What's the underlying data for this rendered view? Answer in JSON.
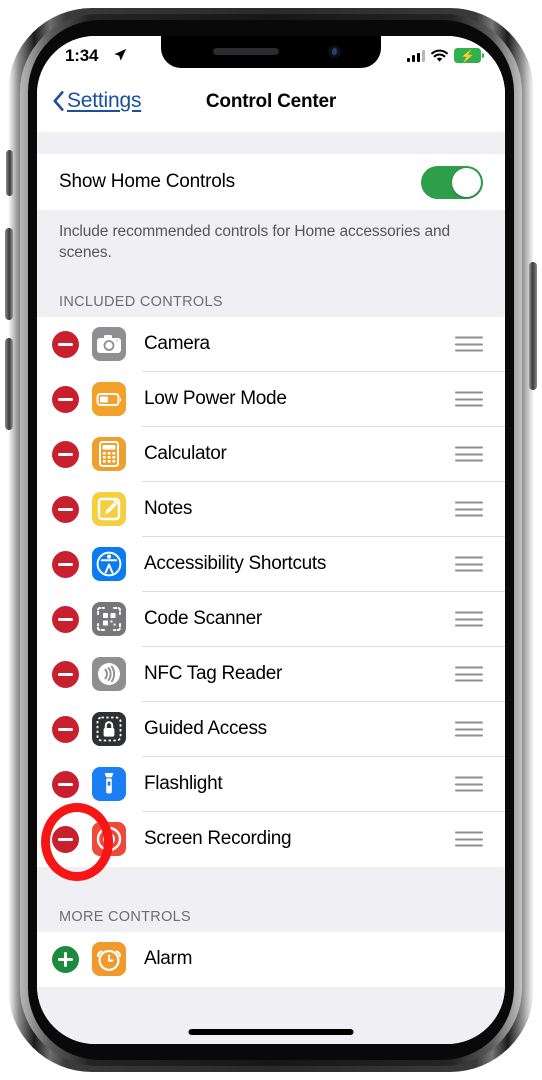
{
  "status_bar": {
    "time": "1:34",
    "location_icon": "location-arrow-icon",
    "signal_icon": "cellular-bars-icon",
    "wifi_icon": "wifi-icon",
    "battery_icon": "battery-charging-icon",
    "battery_bolt": "⚡"
  },
  "nav": {
    "back_label": "Settings",
    "back_icon": "chevron-left-icon",
    "title": "Control Center"
  },
  "home_controls": {
    "label": "Show Home Controls",
    "toggle_state": "on",
    "toggle_color": "#2e9e4a",
    "footnote": "Include recommended controls for Home accessories and scenes."
  },
  "included": {
    "header": "INCLUDED CONTROLS",
    "items": [
      {
        "label": "Camera",
        "icon": "camera-icon",
        "icon_color": "#8e8e93",
        "action": "remove",
        "handle": "drag-handle-icon"
      },
      {
        "label": "Low Power Mode",
        "icon": "battery-low-icon",
        "icon_color": "#f2a12a",
        "action": "remove",
        "handle": "drag-handle-icon"
      },
      {
        "label": "Calculator",
        "icon": "calculator-icon",
        "icon_color": "#eda02c",
        "action": "remove",
        "handle": "drag-handle-icon"
      },
      {
        "label": "Notes",
        "icon": "notes-pencil-icon",
        "icon_color": "#f7ce3e",
        "action": "remove",
        "handle": "drag-handle-icon"
      },
      {
        "label": "Accessibility Shortcuts",
        "icon": "accessibility-icon",
        "icon_color": "#0b7cf0",
        "action": "remove",
        "handle": "drag-handle-icon"
      },
      {
        "label": "Code Scanner",
        "icon": "qr-scanner-icon",
        "icon_color": "#76767b",
        "action": "remove",
        "handle": "drag-handle-icon"
      },
      {
        "label": "NFC Tag Reader",
        "icon": "nfc-icon",
        "icon_color": "#8e8e93",
        "action": "remove",
        "handle": "drag-handle-icon"
      },
      {
        "label": "Guided Access",
        "icon": "lock-dashed-icon",
        "icon_color": "#2f3033",
        "action": "remove",
        "handle": "drag-handle-icon"
      },
      {
        "label": "Flashlight",
        "icon": "flashlight-icon",
        "icon_color": "#1b7ef2",
        "action": "remove",
        "handle": "drag-handle-icon"
      },
      {
        "label": "Screen Recording",
        "icon": "record-circle-icon",
        "icon_color": "#ee4a3b",
        "action": "remove",
        "handle": "drag-handle-icon"
      }
    ]
  },
  "more": {
    "header": "MORE CONTROLS",
    "items": [
      {
        "label": "Alarm",
        "icon": "alarm-clock-icon",
        "icon_color": "#f2992b",
        "action": "add"
      }
    ]
  },
  "annotation": {
    "shape": "ellipse-highlight",
    "color": "#f71616",
    "target": "Flashlight remove button"
  },
  "remove_button_color": "#c9202f",
  "add_button_color": "#1d8a3e"
}
